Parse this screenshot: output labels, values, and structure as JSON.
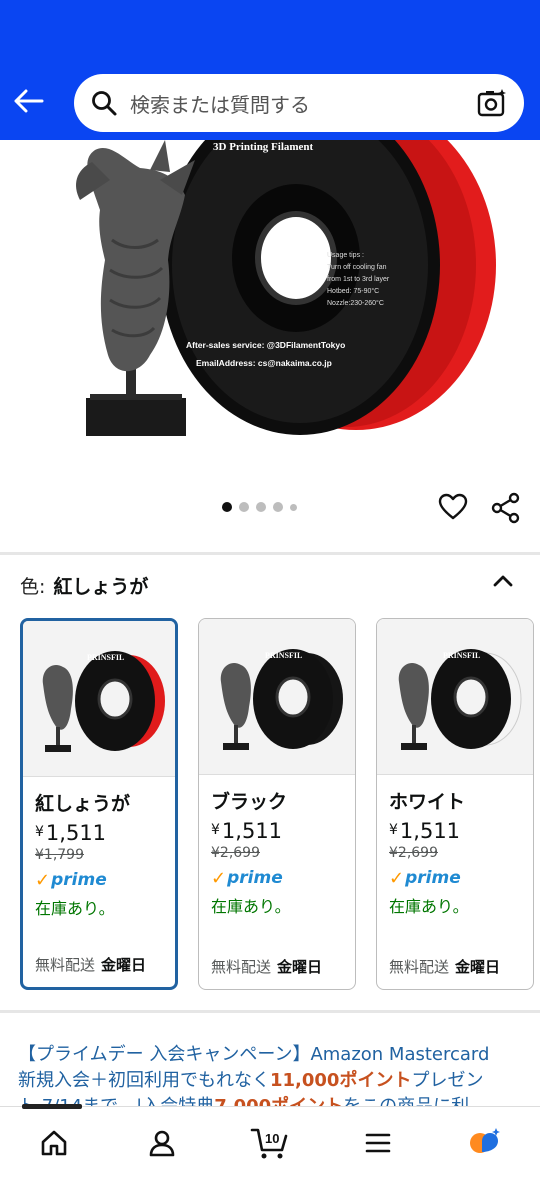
{
  "search": {
    "placeholder": "検索または質問する"
  },
  "product_image": {
    "spool_label": "3D Printing Filament",
    "usage_tips": [
      "Usage tips :",
      "Turn off cooling fan",
      "from 1st to 3rd layer",
      "Hotbed: 75-90°C",
      "Nozzle:230-260°C"
    ],
    "service_line": "After-sales service: @3DFilamentTokyo",
    "email_line": "EmailAddress: cs@nakaima.co.jp",
    "carousel": {
      "count": 5,
      "active": 0
    }
  },
  "color_section": {
    "label": "色:",
    "selected": "紅しょうが",
    "options": [
      {
        "name": "紅しょうが",
        "price": "1,511",
        "list_price": "¥1,799",
        "prime": "prime",
        "stock": "在庫あり。",
        "ship_label": "無料配送",
        "ship_day": "金曜日",
        "spool_color": "#e01b1b",
        "brand": "PRINSFIL",
        "selected": true
      },
      {
        "name": "ブラック",
        "price": "1,511",
        "list_price": "¥2,699",
        "prime": "prime",
        "stock": "在庫あり。",
        "ship_label": "無料配送",
        "ship_day": "金曜日",
        "spool_color": "#151515",
        "brand": "PRINSFIL",
        "selected": false
      },
      {
        "name": "ホワイト",
        "price": "1,511",
        "list_price": "¥2,699",
        "prime": "prime",
        "stock": "在庫あり。",
        "ship_label": "無料配送",
        "ship_day": "金曜日",
        "spool_color": "#f4f4f4",
        "brand": "PRINSFIL",
        "selected": false
      }
    ]
  },
  "currency": "¥",
  "promo": {
    "line1": "【プライムデー 入会キャンペーン】Amazon Mastercard",
    "line2_pre": "新規入会＋初回利用でもれなく",
    "line2_hl": "11,000ポイント",
    "line2_post": "プレゼン",
    "line3_pre": "ト 7/14まで",
    "line3_mid": "入会特典",
    "line3_hl": "7,000ポイント",
    "line3_post": "をこの商品に利"
  },
  "bottom_nav": {
    "cart_count": "10"
  },
  "colors": {
    "header": "#0a45f2",
    "link": "#2162a1",
    "prime": "#1f8ad2",
    "stock": "#007600"
  }
}
